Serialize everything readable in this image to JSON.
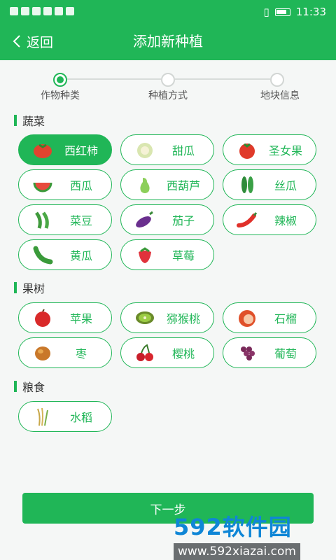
{
  "status": {
    "time": "11:33"
  },
  "header": {
    "back_label": "返回",
    "title": "添加新种植"
  },
  "steps": [
    {
      "label": "作物种类",
      "active": true
    },
    {
      "label": "种植方式",
      "active": false
    },
    {
      "label": "地块信息",
      "active": false
    }
  ],
  "sections": {
    "vegetables": {
      "title": "蔬菜",
      "items": [
        {
          "label": "西红柿",
          "icon": "tomato-icon",
          "selected": true
        },
        {
          "label": "甜瓜",
          "icon": "melon-icon"
        },
        {
          "label": "圣女果",
          "icon": "cherry-tomato-icon"
        },
        {
          "label": "西瓜",
          "icon": "watermelon-icon"
        },
        {
          "label": "西葫芦",
          "icon": "zucchini-icon"
        },
        {
          "label": "丝瓜",
          "icon": "luffa-icon"
        },
        {
          "label": "菜豆",
          "icon": "bean-icon"
        },
        {
          "label": "茄子",
          "icon": "eggplant-icon"
        },
        {
          "label": "辣椒",
          "icon": "chili-icon"
        },
        {
          "label": "黄瓜",
          "icon": "cucumber-icon"
        },
        {
          "label": "草莓",
          "icon": "strawberry-icon"
        }
      ]
    },
    "fruit_trees": {
      "title": "果树",
      "items": [
        {
          "label": "苹果",
          "icon": "apple-icon"
        },
        {
          "label": "猕猴桃",
          "icon": "kiwi-icon"
        },
        {
          "label": "石榴",
          "icon": "pomegranate-icon"
        },
        {
          "label": "枣",
          "icon": "jujube-icon"
        },
        {
          "label": "樱桃",
          "icon": "cherry-icon"
        },
        {
          "label": "葡萄",
          "icon": "grape-icon"
        }
      ]
    },
    "grains": {
      "title": "粮食",
      "items": [
        {
          "label": "水稻",
          "icon": "rice-icon"
        }
      ]
    }
  },
  "next_label": "下一步",
  "watermark": {
    "brand": "592软件园",
    "url": "www.592xiazai.com"
  },
  "colors": {
    "accent": "#20b657"
  }
}
